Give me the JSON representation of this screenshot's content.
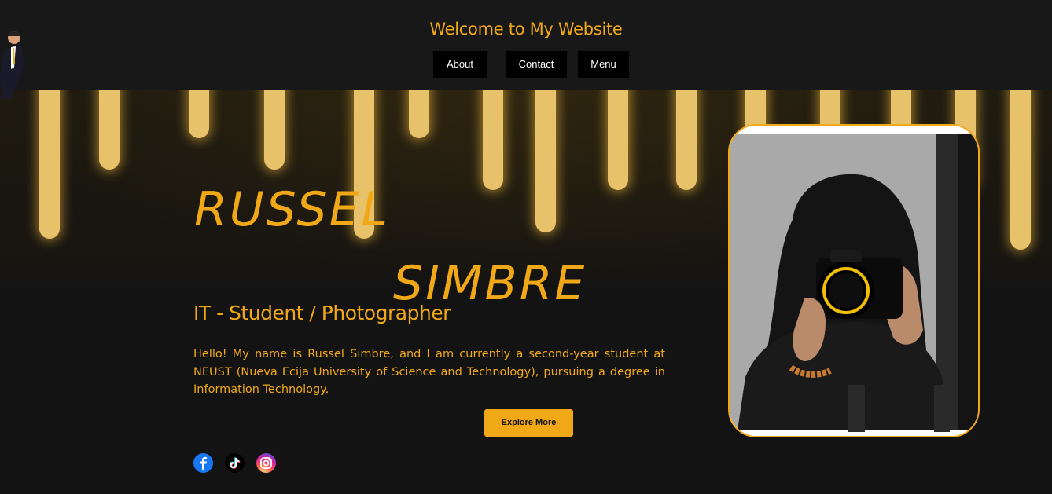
{
  "header": {
    "title": "Welcome to My Website",
    "nav": [
      {
        "label": "About"
      },
      {
        "label": "Contact"
      },
      {
        "label": "Menu"
      }
    ]
  },
  "hero": {
    "first_name": "RUSSEL",
    "last_name": "SIMBRE",
    "role": "IT - Student / Photographer",
    "bio": "Hello! My name is Russel Simbre, and I am currently a second-year student at NEUST (Nueva Ecija University of Science and Technology), pursuing a degree in Information Technology.",
    "cta_label": "Explore More"
  },
  "social": [
    {
      "icon": "facebook-icon"
    },
    {
      "icon": "tiktok-icon"
    },
    {
      "icon": "instagram-icon"
    }
  ],
  "colors": {
    "accent": "#f0a817",
    "header_bg": "#181818",
    "page_bg": "#141414",
    "nav_bg": "#000000"
  }
}
